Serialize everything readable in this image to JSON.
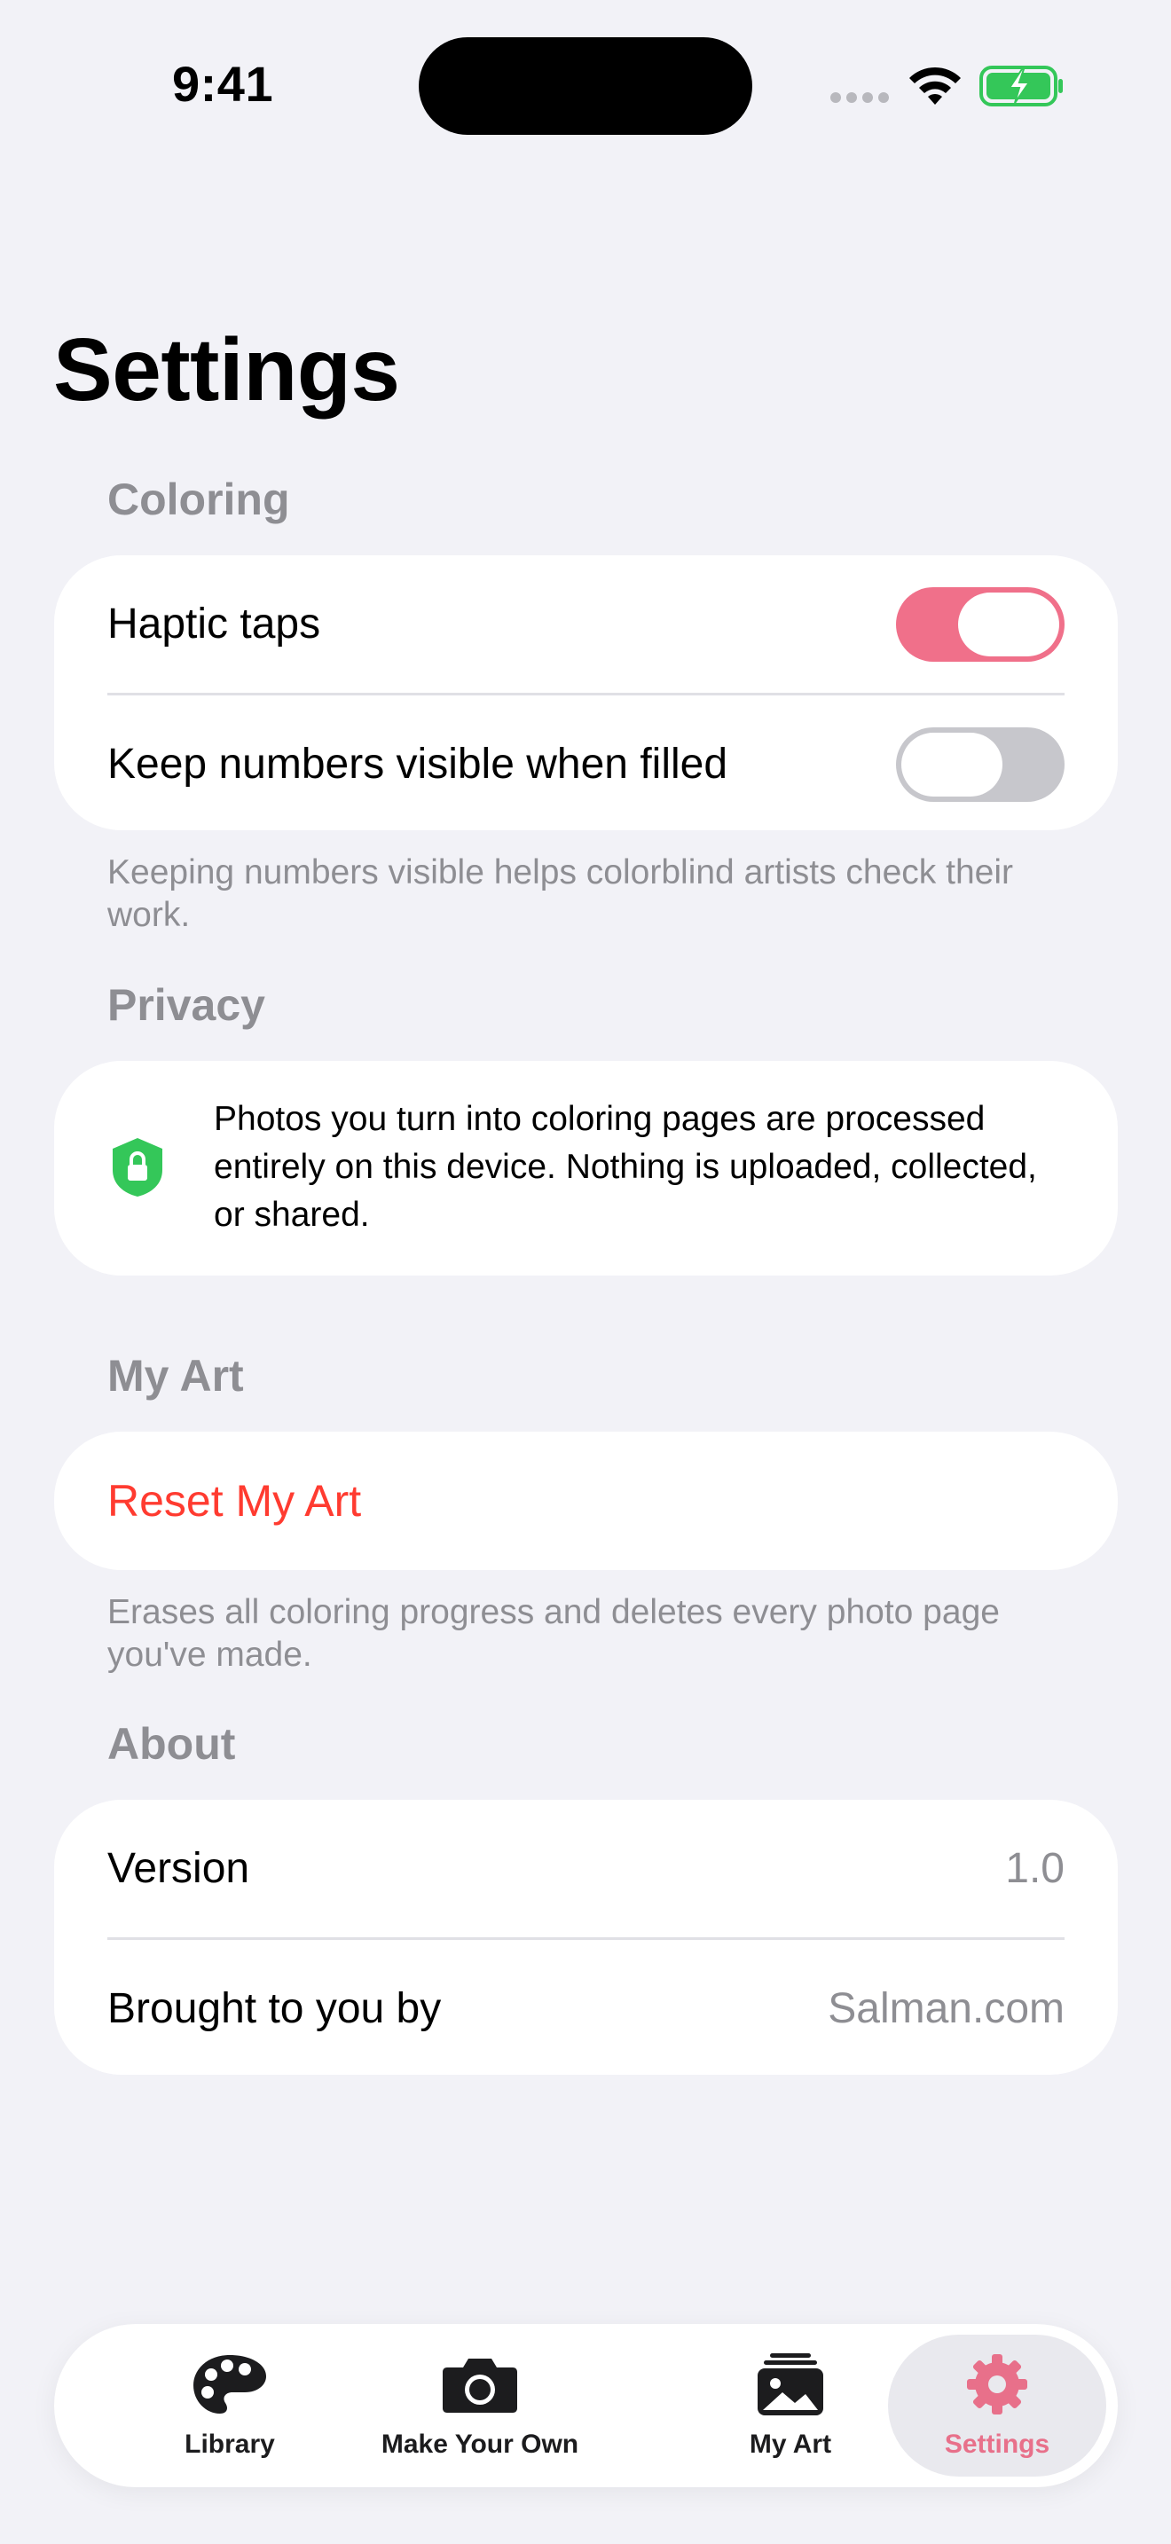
{
  "status_bar": {
    "time": "9:41"
  },
  "page": {
    "title": "Settings"
  },
  "coloring": {
    "header": "Coloring",
    "haptic_label": "Haptic taps",
    "haptic_on": true,
    "keep_numbers_label": "Keep numbers visible when filled",
    "keep_numbers_on": false,
    "footer": "Keeping numbers visible helps colorblind artists check their work."
  },
  "privacy": {
    "header": "Privacy",
    "text": "Photos you turn into coloring pages are processed entirely on this device. Nothing is uploaded, collected, or shared.",
    "icon": "shield-lock-icon"
  },
  "my_art": {
    "header": "My Art",
    "reset_label": "Reset My Art",
    "footer": "Erases all coloring progress and deletes every photo page you've made."
  },
  "about": {
    "header": "About",
    "version_label": "Version",
    "version_value": "1.0",
    "by_label": "Brought to you by",
    "by_value": "Salman.com"
  },
  "tab_bar": {
    "selected": "Settings",
    "tabs": [
      {
        "label": "Library",
        "icon": "palette-icon"
      },
      {
        "label": "Make Your Own",
        "icon": "camera-icon"
      },
      {
        "label": "My Art",
        "icon": "photo-stack-icon"
      },
      {
        "label": "Settings",
        "icon": "gear-icon"
      }
    ]
  },
  "colors": {
    "accent": "#F0708A",
    "destructive": "#FF3B30",
    "background": "#F2F2F7",
    "secondary_text": "#8E8E93",
    "privacy_green": "#34C759"
  }
}
